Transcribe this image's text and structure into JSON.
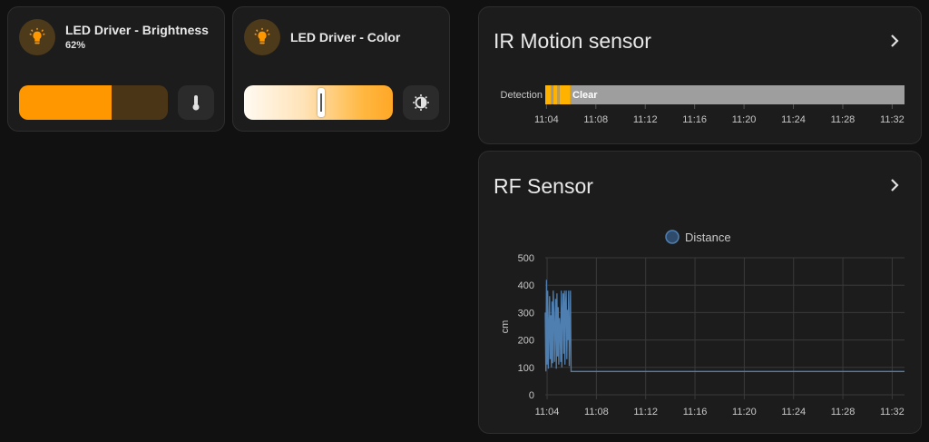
{
  "colors": {
    "accent": "#ff9800",
    "accent_dim": "#4d3a1a",
    "card_bg": "#1c1c1c",
    "timeline_active": "#ffb300",
    "timeline_clear": "#9e9e9e",
    "series_line": "#4f7fb0"
  },
  "tiles": [
    {
      "name": "LED Driver - Brightness",
      "state": "62%",
      "icon": "led-bulb-icon",
      "control": "brightness-slider",
      "brightness_percent": 62,
      "button_icon": "thermometer-icon"
    },
    {
      "name": "LED Driver - Color",
      "icon": "led-bulb-icon",
      "control": "color-temperature-slider",
      "color_temp_position_percent": 52,
      "button_icon": "brightness-icon"
    }
  ],
  "ir_card": {
    "title": "IR Motion sensor",
    "row_label": "Detection",
    "state_label": "Clear",
    "x_ticks": [
      "11:04",
      "11:08",
      "11:12",
      "11:16",
      "11:20",
      "11:24",
      "11:28",
      "11:32"
    ]
  },
  "rf_card": {
    "title": "RF Sensor",
    "legend": "Distance",
    "y_axis_label": "cm",
    "y_ticks": [
      "0",
      "100",
      "200",
      "300",
      "400",
      "500"
    ],
    "x_ticks": [
      "11:04",
      "11:08",
      "11:12",
      "11:16",
      "11:20",
      "11:24",
      "11:28",
      "11:32"
    ]
  },
  "chart_data": [
    {
      "type": "timeline",
      "title": "IR Motion sensor",
      "rows": [
        {
          "label": "Detection",
          "segments": [
            {
              "start": "11:03.9",
              "end": "11:04.4",
              "state": "Detected"
            },
            {
              "start": "11:04.4",
              "end": "11:04.55",
              "state": "Clear"
            },
            {
              "start": "11:04.55",
              "end": "11:04.9",
              "state": "Detected"
            },
            {
              "start": "11:04.9",
              "end": "11:05.05",
              "state": "Clear"
            },
            {
              "start": "11:05.05",
              "end": "11:05.95",
              "state": "Detected"
            },
            {
              "start": "11:05.95",
              "end": "11:33.0",
              "state": "Clear"
            }
          ]
        }
      ],
      "x_range": [
        "11:03.9",
        "11:33.0"
      ]
    },
    {
      "type": "line",
      "title": "RF Sensor",
      "ylabel": "cm",
      "ylim": [
        0,
        500
      ],
      "legend_position": "top-center",
      "grid": true,
      "series": [
        {
          "name": "Distance",
          "x_minutes_after_11": [
            3.85,
            3.9,
            3.95,
            4.0,
            4.05,
            4.1,
            4.15,
            4.2,
            4.25,
            4.3,
            4.35,
            4.4,
            4.45,
            4.5,
            4.55,
            4.6,
            4.65,
            4.7,
            4.75,
            4.8,
            4.85,
            4.9,
            4.95,
            5.0,
            5.05,
            5.1,
            5.15,
            5.2,
            5.25,
            5.3,
            5.35,
            5.4,
            5.45,
            5.5,
            5.55,
            5.6,
            5.65,
            5.7,
            5.75,
            5.8,
            5.85,
            5.9,
            5.95,
            6.0,
            33.0
          ],
          "y": [
            300,
            85,
            420,
            110,
            380,
            95,
            250,
            360,
            130,
            290,
            100,
            340,
            115,
            380,
            300,
            120,
            260,
            350,
            95,
            370,
            140,
            320,
            110,
            280,
            240,
            120,
            380,
            100,
            300,
            370,
            150,
            380,
            110,
            330,
            380,
            130,
            310,
            200,
            380,
            105,
            250,
            380,
            85,
            85,
            85
          ]
        }
      ]
    }
  ]
}
